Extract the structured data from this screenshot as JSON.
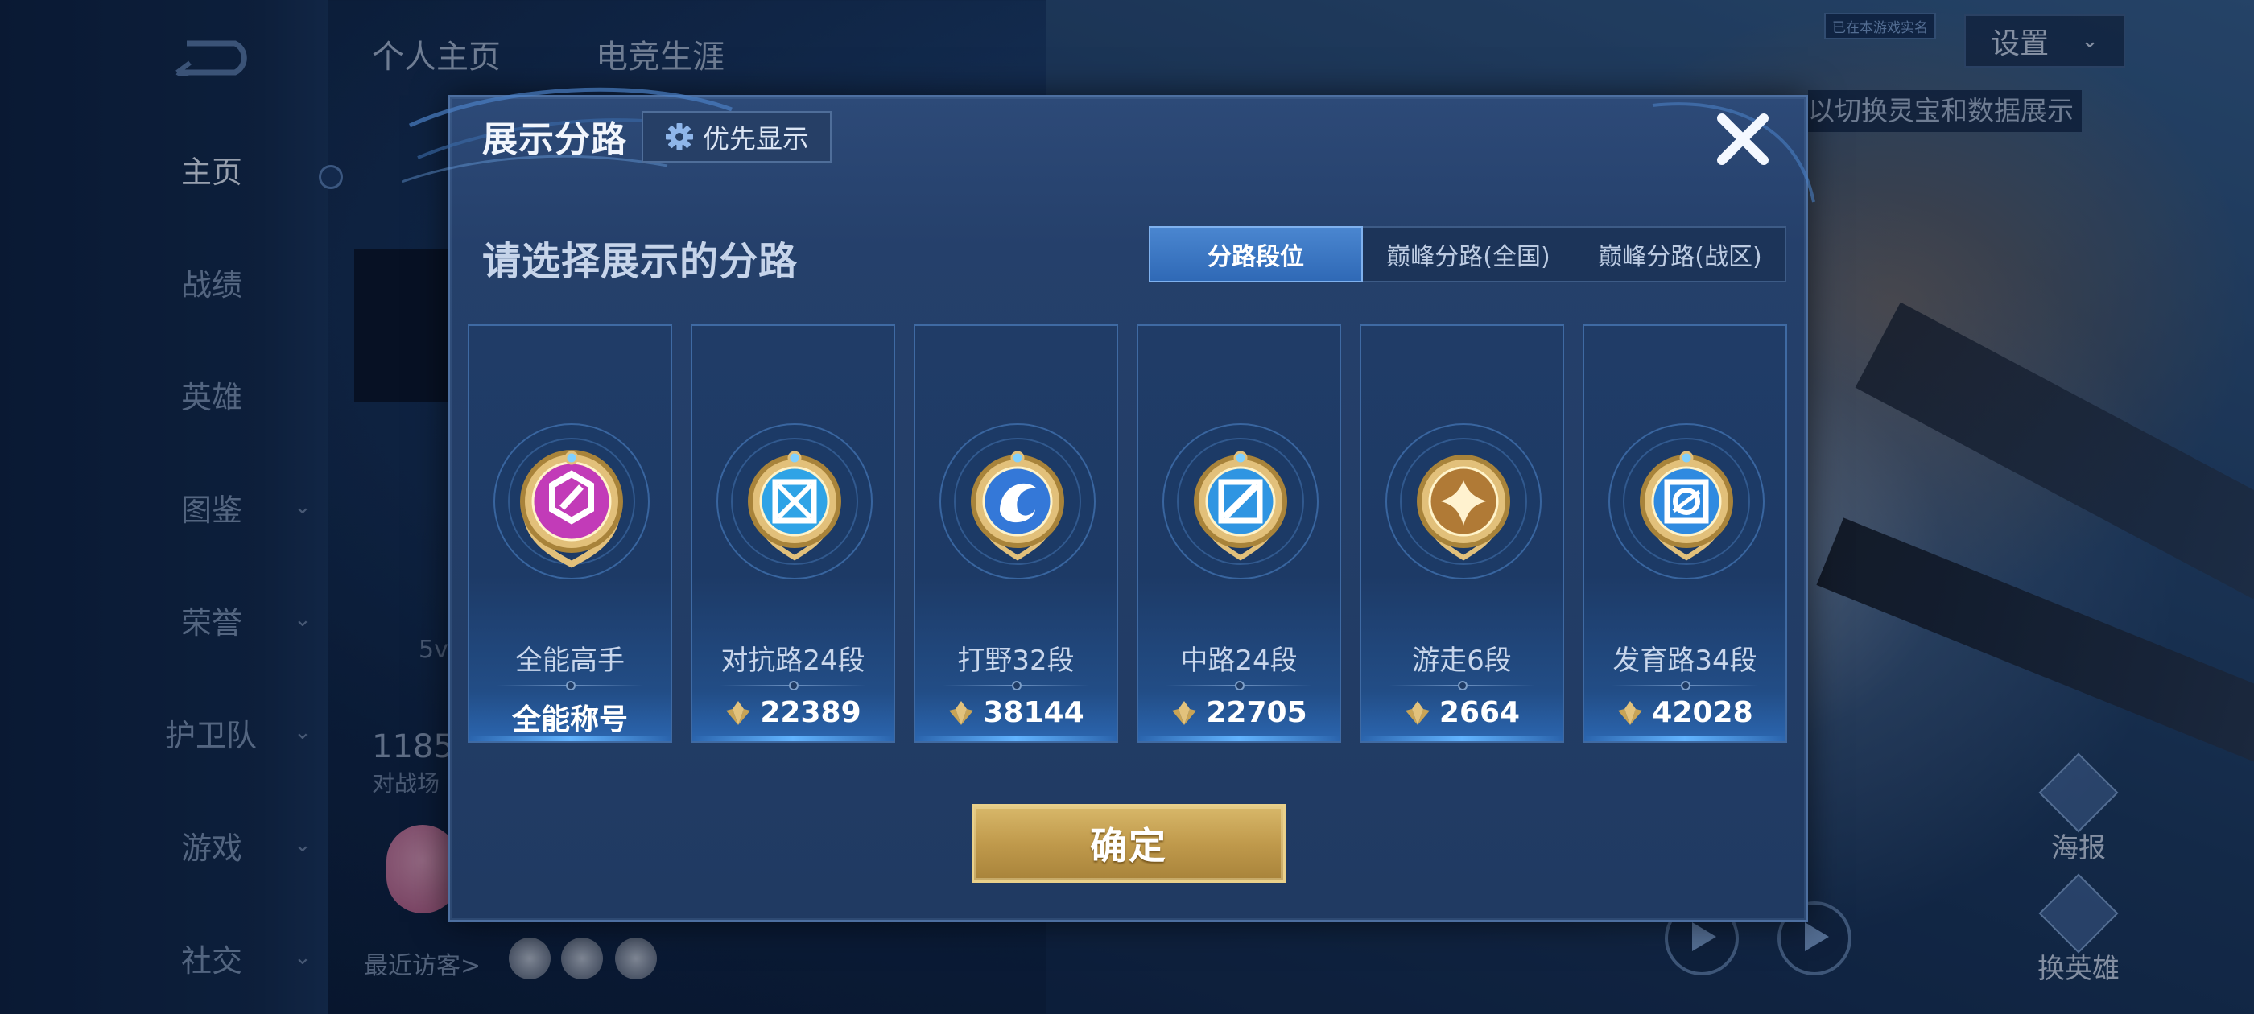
{
  "background": {
    "sidebar_items": [
      {
        "label": "主页",
        "expandable": false,
        "active": true
      },
      {
        "label": "战绩",
        "expandable": false,
        "active": false
      },
      {
        "label": "英雄",
        "expandable": false,
        "active": false
      },
      {
        "label": "图鉴",
        "expandable": true,
        "active": false
      },
      {
        "label": "荣誉",
        "expandable": true,
        "active": false
      },
      {
        "label": "护卫队",
        "expandable": true,
        "active": false
      },
      {
        "label": "游戏",
        "expandable": true,
        "active": false
      },
      {
        "label": "社交",
        "expandable": true,
        "active": false
      }
    ],
    "top_tabs": [
      "个人主页",
      "电竞生涯"
    ],
    "settings_label": "设置",
    "sync_badge": "已在本游戏实名",
    "tip_text": "以切换灵宝和数据展示",
    "stat_big": "1185",
    "stat_sub": "对战场",
    "stat_mini": "5v",
    "visitors_label": "最近访客>",
    "poster_label": "海报",
    "switch_hero_label": "换英雄"
  },
  "modal": {
    "title": "展示分路",
    "priority_label": "优先显示",
    "section_title": "请选择展示的分路",
    "tabs": [
      {
        "label": "分路段位",
        "selected": true
      },
      {
        "label": "巅峰分路(全国)",
        "selected": false
      },
      {
        "label": "巅峰分路(战区)",
        "selected": false
      }
    ],
    "cards": [
      {
        "name": "全能高手",
        "value": "全能称号",
        "show_icon": false,
        "badge": "all-round-badge-icon",
        "gem_color": "#c23bb8"
      },
      {
        "name": "对抗路24段",
        "value": "22389",
        "show_icon": true,
        "badge": "clash-lane-badge-icon",
        "gem_color": "#2fa3e6"
      },
      {
        "name": "打野32段",
        "value": "38144",
        "show_icon": true,
        "badge": "jungle-badge-icon",
        "gem_color": "#3478d8"
      },
      {
        "name": "中路24段",
        "value": "22705",
        "show_icon": true,
        "badge": "mid-lane-badge-icon",
        "gem_color": "#2f95e2"
      },
      {
        "name": "游走6段",
        "value": "2664",
        "show_icon": true,
        "badge": "roam-badge-icon",
        "gem_color": "#b07a36"
      },
      {
        "name": "发育路34段",
        "value": "42028",
        "show_icon": true,
        "badge": "farm-lane-badge-icon",
        "gem_color": "#2f8ae0"
      }
    ],
    "confirm_label": "确定"
  },
  "colors": {
    "accent_blue": "#3d78c7",
    "gold": "#c9a455",
    "modal_bg": "#243f69"
  }
}
